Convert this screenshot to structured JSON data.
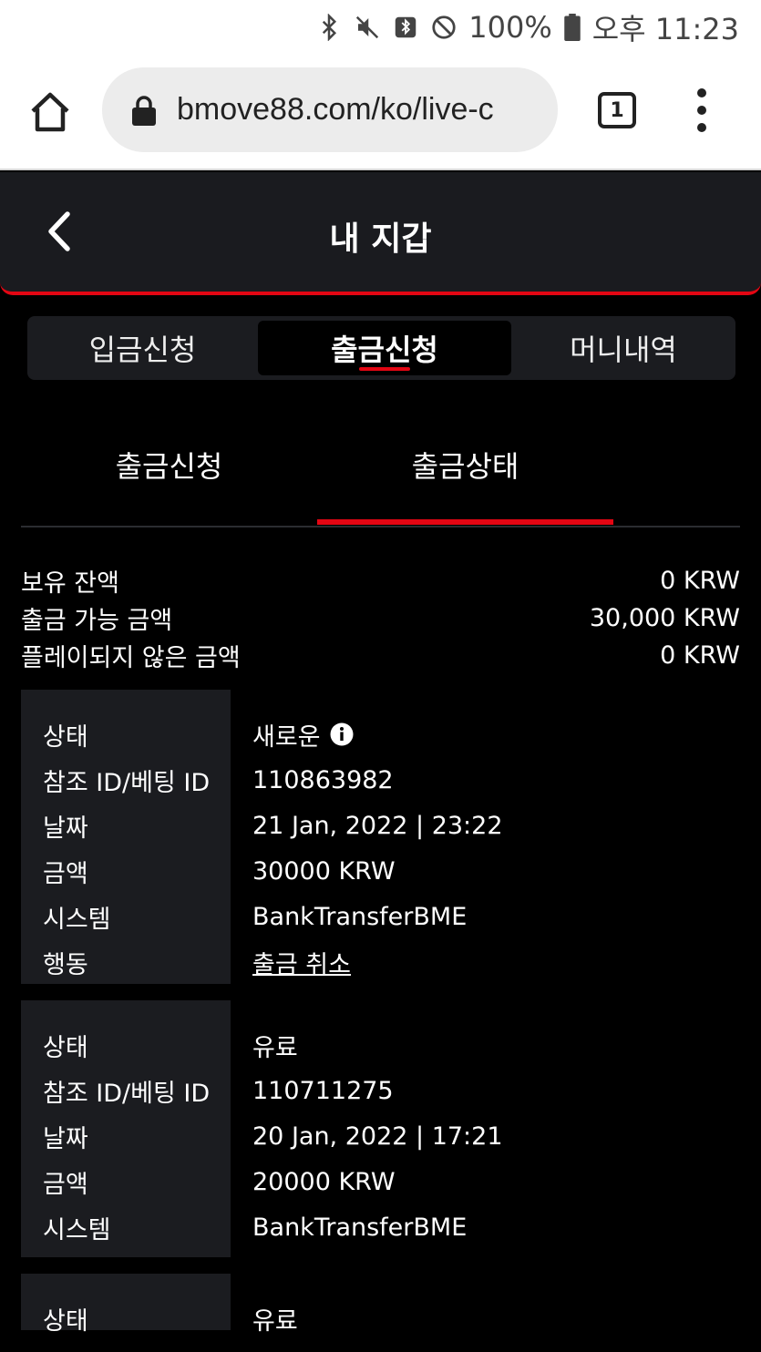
{
  "statusbar": {
    "battery": "100%",
    "time": "오후 11:23",
    "icons": [
      "bluetooth-icon",
      "mute-icon",
      "nfc-icon",
      "do-not-disturb-icon",
      "battery-icon"
    ]
  },
  "browser": {
    "url": "bmove88.com/ko/live-c",
    "tab_count": "1"
  },
  "header": {
    "title": "내 지갑"
  },
  "tabs": [
    {
      "label": "입금신청",
      "active": false
    },
    {
      "label": "출금신청",
      "active": true
    },
    {
      "label": "머니내역",
      "active": false
    }
  ],
  "subtabs": [
    {
      "label": "출금신청",
      "active": false
    },
    {
      "label": "출금상태",
      "active": true
    }
  ],
  "balances": [
    {
      "label": "보유 잔액",
      "value": "0 KRW"
    },
    {
      "label": "출금 가능 금액",
      "value": "30,000 KRW"
    },
    {
      "label": "플레이되지 않은 금액",
      "value": "0 KRW"
    }
  ],
  "labels": {
    "status": "상태",
    "ref_id": "참조 ID/베팅 ID",
    "date": "날짜",
    "amount": "금액",
    "system": "시스템",
    "action": "행동"
  },
  "records": [
    {
      "status": "새로운",
      "ref_id": "110863982",
      "date": "21 Jan, 2022 | 23:22",
      "amount": "30000 KRW",
      "system": "BankTransferBME",
      "action": "출금 취소"
    },
    {
      "status": "유료",
      "ref_id": "110711275",
      "date": "20 Jan, 2022 | 17:21",
      "amount": "20000 KRW",
      "system": "BankTransferBME"
    },
    {
      "status": "유료"
    }
  ],
  "colors": {
    "accent": "#e30613",
    "background": "#000000",
    "panel": "#1b1c20"
  }
}
